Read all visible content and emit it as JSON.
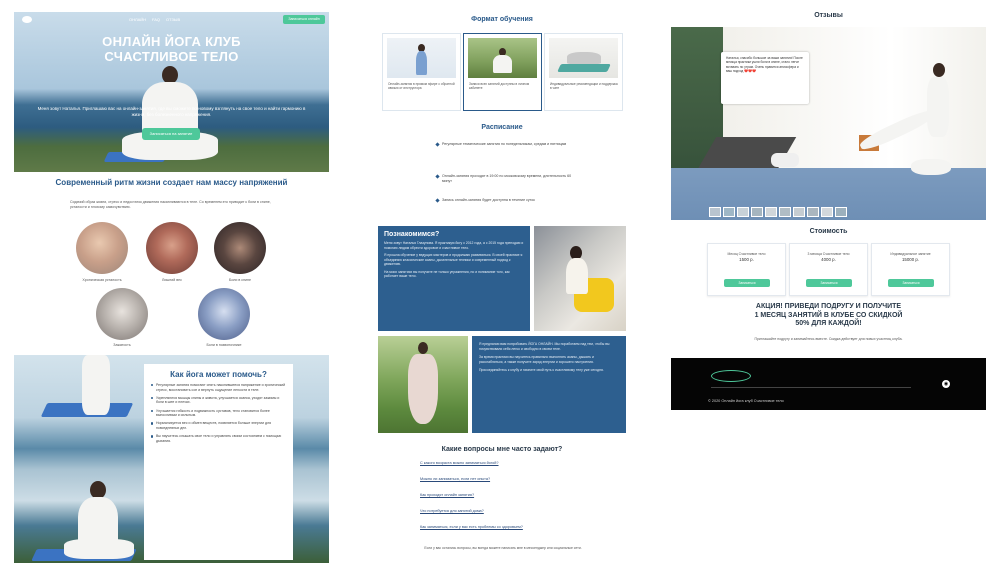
{
  "hero": {
    "nav": [
      "ОНЛАЙН",
      "FAQ",
      "ОТЗЫВ"
    ],
    "nav_button": "Записаться онлайн",
    "title_line1": "ОНЛАЙН ЙОГА КЛУБ",
    "title_line2": "СЧАСТЛИВОЕ ТЕЛО",
    "subtitle": "Меня зовут Наталья. Приглашаю вас на онлайн-занятия, где вы сможете по-новому взглянуть на свое тело и найти гармонию в жизни, без болезненного напряжения.",
    "cta": "Записаться на занятие"
  },
  "stress": {
    "title": "Современный ритм жизни создает нам массу напряжений",
    "text": "Сидячий образ жизни, стресс и недостаток движения накапливаются в теле. Со временем это приводит к боли в спине, усталости и плохому самочувствию.",
    "items": [
      "Хроническая усталость",
      "Лишний вес",
      "Боли в спине",
      "Зажатость",
      "Боли в позвоночнике"
    ]
  },
  "help": {
    "title": "Как йога может помочь?",
    "items": [
      "Регулярные занятия помогают снять накопившееся напряжение и хронический стресс, восстановить сон и вернуть ощущение легкости в теле.",
      "Укрепляются мышцы спины и живота, улучшается осанка, уходят зажимы и боли в шее и плечах.",
      "Улучшается гибкость и подвижность суставов, тело становится более выносливым и сильным.",
      "Нормализуется вес и обмен веществ, появляется больше энергии для повседневных дел.",
      "Вы научитесь слышать свое тело и управлять своим состоянием с помощью дыхания."
    ]
  },
  "format": {
    "title": "Формат обучения",
    "cards": [
      "Онлайн-занятия в прямом эфире с обратной связью от инструктора",
      "Записи всех занятий доступны в личном кабинете",
      "Индивидуальные рекомендации и поддержка в чате"
    ]
  },
  "schedule": {
    "title": "Расписание",
    "items": [
      "Регулярные тематические занятия по понедельникам, средам и пятницам",
      "Онлайн-занятия проходят в 19:00 по московскому времени, длительность 60 минут",
      "Запись онлайн-занятия будет доступна в течение суток"
    ]
  },
  "meet": {
    "title": "Познакомимся?",
    "p1": "Меня зовут Наталья Глазунова. Я практикую йогу с 2012 года, а с 2015 года преподаю и помогаю людям обрести здоровое и счастливое тело.",
    "p2": "Я прошла обучение у ведущих мастеров и продолжаю развиваться. В своей практике я объединяю классические асаны, дыхательные техники и современный подход к движению.",
    "p3": "На моих занятиях вы получите не только упражнения, но и понимание того, как работает ваше тело."
  },
  "offer": {
    "p1": "Я предлагаю вам попробовать ЙОГА ОНЛАЙН. Мы поработаем над тем, чтобы вы почувствовали себя легко и свободно в своем теле.",
    "p2": "За время практики вы научитесь правильно выполнять асаны, дышать и расслабляться, а также получите заряд энергии и хорошего настроения.",
    "p3": "Присоединяйтесь к клубу и начните свой путь к счастливому телу уже сегодня."
  },
  "faq": {
    "title": "Какие вопросы мне часто задают?",
    "questions": [
      "С какого возраста можно заниматься йогой?",
      "Можно ли заниматься, если нет опыта?",
      "Как проходят онлайн занятия?",
      "Что потребуется для занятий дома?",
      "Как заниматься, если у вас есть проблемы со здоровьем?"
    ],
    "footer": "Если у вас остались вопросы, вы всегда можете написать мне в мессенджер или социальные сети."
  },
  "reviews": {
    "title": "Отзывы",
    "bubble": "Наталья, спасибо большое за ваши занятия! После месяца практики ушли боли в спине, стало легче вставать по утрам. Очень нравится атмосфера и ваш подход ❤️❤️❤️"
  },
  "pricing": {
    "title": "Стоимость",
    "cards": [
      {
        "name": "Месяц Счастливое тело",
        "price": "1500 р.",
        "button": "Записаться"
      },
      {
        "name": "3 месяца Счастливое тело",
        "price": "4000 р.",
        "button": "Записаться"
      },
      {
        "name": "Индивидуальное занятие",
        "price": "15000 р.",
        "button": "Записаться"
      }
    ]
  },
  "promo": {
    "line1": "АКЦИЯ! ПРИВЕДИ ПОДРУГУ И ПОЛУЧИТЕ",
    "line2": "1 МЕСЯЦ ЗАНЯТИЙ В КЛУБЕ СО СКИДКОЙ",
    "line3": "50% ДЛЯ КАЖДОЙ!",
    "sub": "Приглашайте подругу и занимайтесь вместе. Скидка действует для новых участниц клуба."
  },
  "footer": {
    "copyright": "© 2020 Онлайн йога клуб Счастливое тело",
    "icon": "instagram-icon"
  },
  "colors": {
    "accent": "#4ec89a",
    "primary": "#2a5a8a",
    "panel": "#2d5f8f"
  }
}
